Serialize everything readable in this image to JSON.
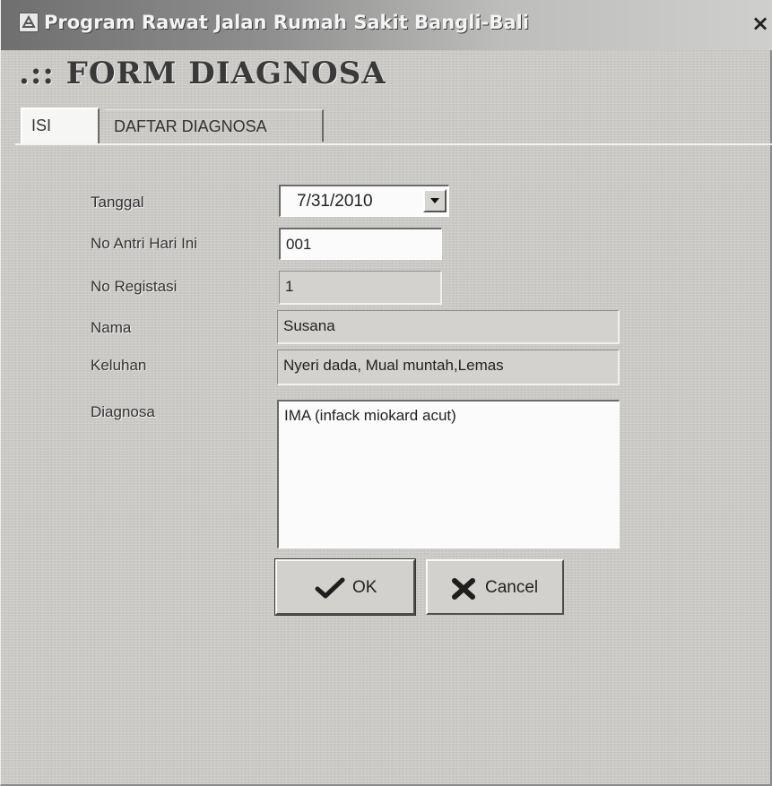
{
  "window": {
    "title": "Program Rawat Jalan Rumah Sakit Bangli-Bali",
    "close_label": "×"
  },
  "form_heading": ".:: FORM DIAGNOSA",
  "tabs": [
    {
      "label": "ISI",
      "active": true
    },
    {
      "label": "DAFTAR DIAGNOSA",
      "active": false
    }
  ],
  "fields": {
    "tanggal": {
      "label": "Tanggal",
      "value": "7/31/2010"
    },
    "no_antri": {
      "label": "No Antri Hari Ini",
      "value": "001"
    },
    "no_registrasi": {
      "label": "No Registasi",
      "value": "1"
    },
    "nama": {
      "label": "Nama",
      "value": "Susana"
    },
    "keluhan": {
      "label": "Keluhan",
      "value": "Nyeri dada, Mual muntah,Lemas"
    },
    "diagnosa": {
      "label": "Diagnosa",
      "value": "IMA (infack miokard acut)"
    }
  },
  "buttons": {
    "ok_label": "OK",
    "cancel_label": "Cancel"
  },
  "icons": {
    "app": "app-icon",
    "dropdown": "chevron-down-icon",
    "ok": "checkmark-icon",
    "cancel": "x-icon"
  }
}
